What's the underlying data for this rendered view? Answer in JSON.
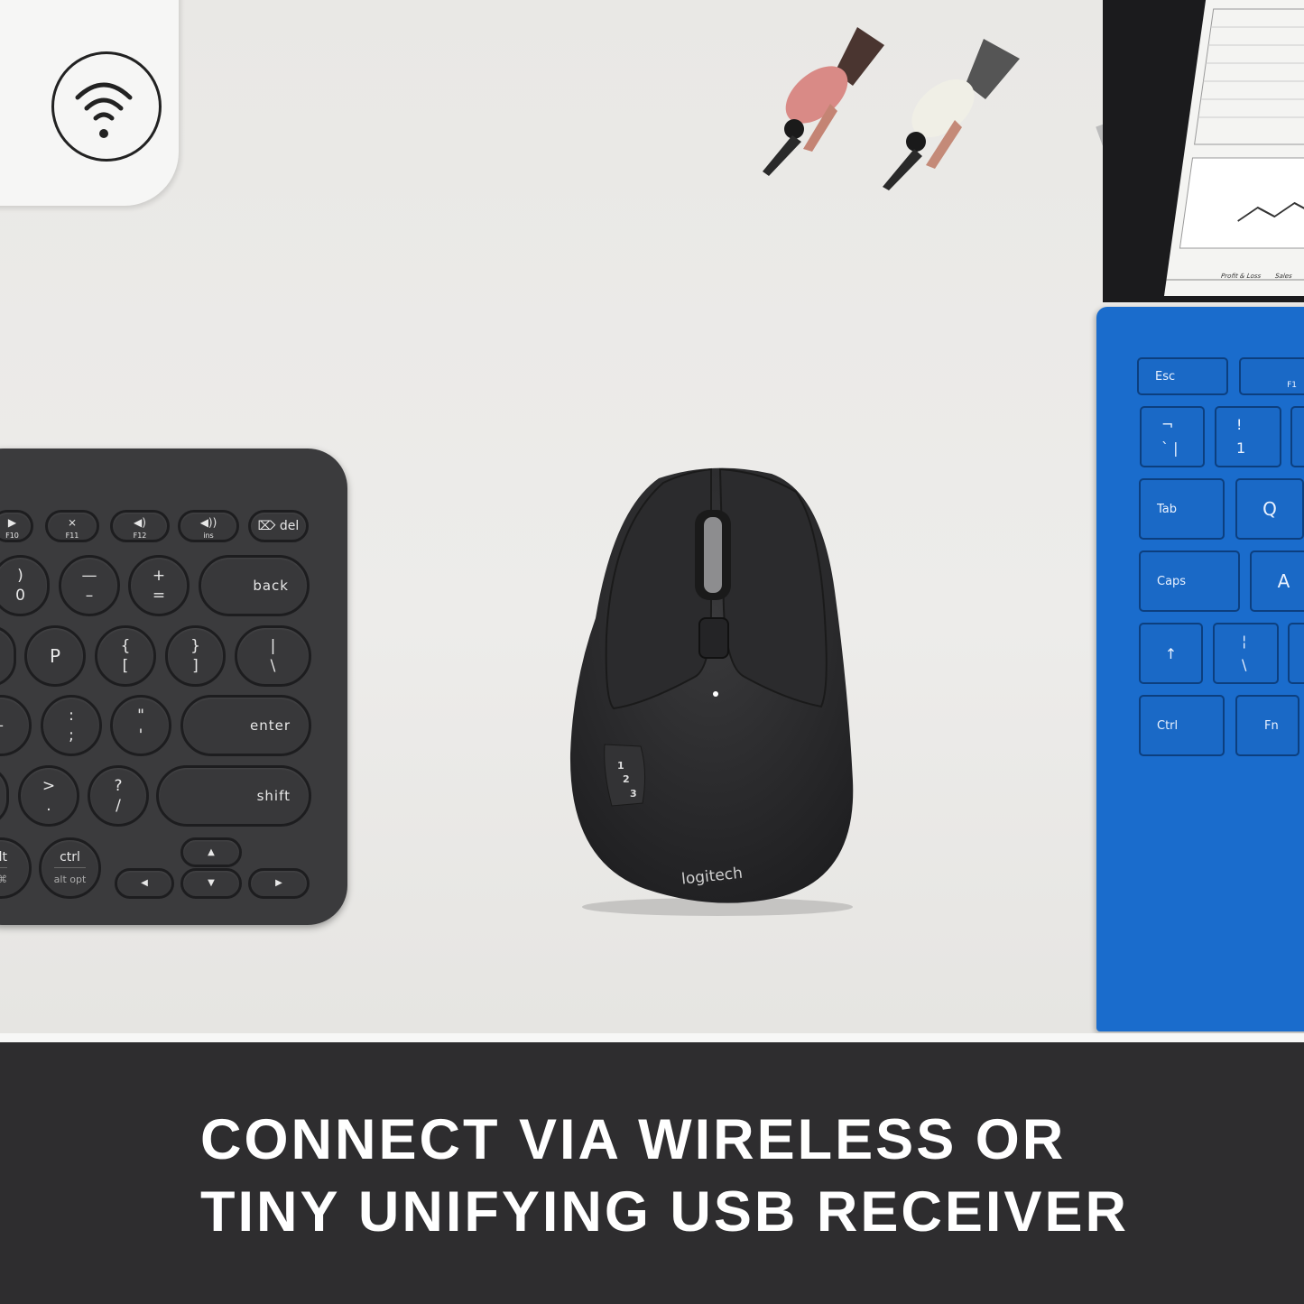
{
  "banner": {
    "line1": "CONNECT VIA WIRELESS OR",
    "line2": "TINY UNIFYING USB RECEIVER",
    "background": "#2e2d2f",
    "text_color": "#ffffff"
  },
  "mouse": {
    "brand": "logitech",
    "channel_buttons": [
      "1",
      "2",
      "3"
    ],
    "color": "#2c2c2e"
  },
  "puck": {
    "icon": "wifi-icon"
  },
  "keyboard": {
    "color": "#3b3b3d",
    "keys": {
      "f10": {
        "main": "▶",
        "sub": "F10"
      },
      "f11": {
        "main": "⨯",
        "sub": "F11"
      },
      "f12": {
        "main": "◀)",
        "sub": "F12"
      },
      "ins": {
        "main": "◀))",
        "sub": "ins"
      },
      "del": {
        "main": "⌦ del"
      },
      "zero": {
        "top": ")",
        "bottom": "0"
      },
      "minus": {
        "top": "—",
        "bottom": "–"
      },
      "equals": {
        "top": "+",
        "bottom": "="
      },
      "back": {
        "main": "back"
      },
      "p": {
        "main": "P"
      },
      "lbracket": {
        "top": "{",
        "bottom": "["
      },
      "rbracket": {
        "top": "}",
        "bottom": "]"
      },
      "backslash": {
        "top": "|",
        "bottom": "\\"
      },
      "l": {
        "main": "–"
      },
      "semicolon": {
        "top": ":",
        "bottom": ";"
      },
      "quote": {
        "top": "\"",
        "bottom": "'"
      },
      "enter": {
        "main": "enter"
      },
      "period": {
        "top": ">",
        "bottom": "."
      },
      "slash": {
        "top": "?",
        "bottom": "/"
      },
      "shift": {
        "main": "shift"
      },
      "alt": {
        "main": "lt",
        "sub": "d ⌘"
      },
      "ctrl": {
        "main": "ctrl",
        "sub": "alt opt"
      },
      "arrow_left": {
        "main": "◀"
      },
      "arrow_up": {
        "main": "▲"
      },
      "arrow_down": {
        "main": "▼"
      },
      "arrow_right": {
        "main": "▶"
      }
    }
  },
  "blue_keyboard": {
    "color": "#1a6ccc",
    "keys": {
      "esc": "Esc",
      "f1": "F1",
      "backtick": {
        "top": "¬",
        "bottom": "`  |"
      },
      "one": {
        "top": "!",
        "bottom": "1"
      },
      "tab": "Tab",
      "q": "Q",
      "caps": "Caps",
      "a": "A",
      "shift": "↑",
      "pipe": {
        "top": "¦",
        "bottom": "\\"
      },
      "ctrl": "Ctrl",
      "fn": "Fn"
    }
  },
  "tablet_screen": {
    "tabs": [
      "Profit & Loss",
      "Sales"
    ]
  }
}
